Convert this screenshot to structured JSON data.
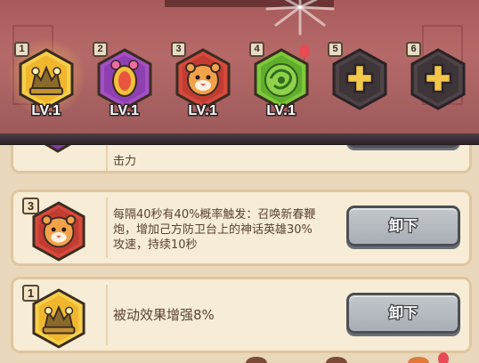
{
  "slots": [
    {
      "index": "1",
      "level": "LV.1",
      "icon": "golden-crest-icon",
      "state": "equipped",
      "selected": true
    },
    {
      "index": "2",
      "level": "LV.1",
      "icon": "purple-lantern-icon",
      "state": "equipped"
    },
    {
      "index": "3",
      "level": "LV.1",
      "icon": "tiger-head-icon",
      "state": "equipped"
    },
    {
      "index": "4",
      "level": "LV.1",
      "icon": "green-jade-icon",
      "state": "equipped"
    },
    {
      "index": "5",
      "icon": "plus-icon",
      "state": "empty"
    },
    {
      "index": "6",
      "icon": "plus-icon",
      "state": "empty"
    }
  ],
  "cards": [
    {
      "desc_line": "击力",
      "icon": "purple-lantern-icon"
    },
    {
      "index": "3",
      "icon": "tiger-head-icon",
      "desc_lines": [
        "每隔40秒有40%概率触发：召唤新春鞭",
        "炮，增加己方防卫台上的神话英雄30%",
        "攻速，持续10秒"
      ],
      "button": "卸下"
    },
    {
      "index": "1",
      "icon": "golden-crest-icon",
      "desc_lines": [
        "被动效果增强8%"
      ],
      "button": "卸下"
    }
  ],
  "colors": {
    "accent_bg": "#b56a68",
    "card_bg": "#f7ecd5",
    "button_gray": "#b4babf",
    "text_brown": "#5a4332"
  }
}
